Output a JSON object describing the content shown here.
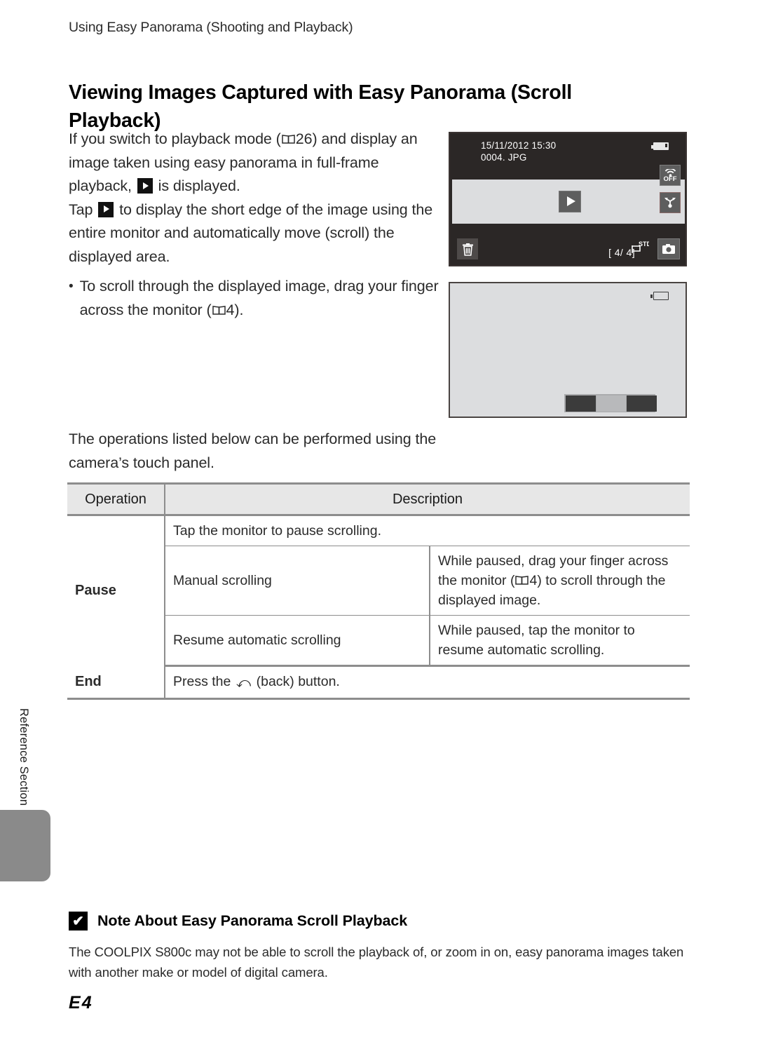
{
  "header": {
    "running_title": "Using Easy Panorama (Shooting and Playback)"
  },
  "title": "Viewing Images Captured with Easy Panorama (Scroll Playback)",
  "body": {
    "intro_line1_a": "If you switch to playback mode (",
    "intro_line1_ref": "26",
    "intro_line1_b": ") and display an image taken using easy panorama in full-frame playback, ",
    "intro_line1_c": " is displayed.",
    "intro_line2_a": "Tap ",
    "intro_line2_b": " to display the short edge of the image using the entire monitor and automatically move (scroll) the displayed area.",
    "bullet_a": "To scroll through the displayed image, drag your finger across the monitor (",
    "bullet_ref": "4",
    "bullet_b": ").",
    "second_intro": "The operations listed below can be performed using the camera’s touch panel."
  },
  "camera_screen_1": {
    "date": "15/11/2012  15:30",
    "filename": "0004. JPG",
    "wifi_label": "OFF",
    "counter": "[    4/      4]",
    "pano_mode": "STD"
  },
  "table": {
    "columns": [
      "Operation",
      "Description"
    ],
    "rows": [
      {
        "operation": "Pause",
        "items": [
          {
            "sub": "",
            "desc": "Tap the monitor to pause scrolling.",
            "span": true
          },
          {
            "sub": "Manual scrolling",
            "desc_a": "While paused, drag your finger across the monitor (",
            "desc_ref": "4",
            "desc_b": ") to scroll through the displayed image."
          },
          {
            "sub": "Resume automatic scrolling",
            "desc": "While paused, tap the monitor to resume automatic scrolling."
          }
        ]
      },
      {
        "operation": "End",
        "items": [
          {
            "sub": "",
            "desc_a": "Press the ",
            "desc_b": " (back) button.",
            "span": true
          }
        ]
      }
    ]
  },
  "side_tab": {
    "label": "Reference Section"
  },
  "note": {
    "mark": "✔",
    "title": "Note About Easy Panorama Scroll Playback",
    "body": "The COOLPIX S800c may not be able to scroll the playback of, or zoom in on, easy panorama images taken with another make or model of digital camera."
  },
  "folio": {
    "mark": "E",
    "number": "4"
  },
  "colors": {
    "page_bg": "#ffffff",
    "text": "#2b2b2b",
    "table_header_bg": "#e7e7e7",
    "rule": "#8d8d8d",
    "tab_grey": "#8a8a8a",
    "screen_dark": "#2b2726",
    "screen_light": "#dcdddf"
  }
}
